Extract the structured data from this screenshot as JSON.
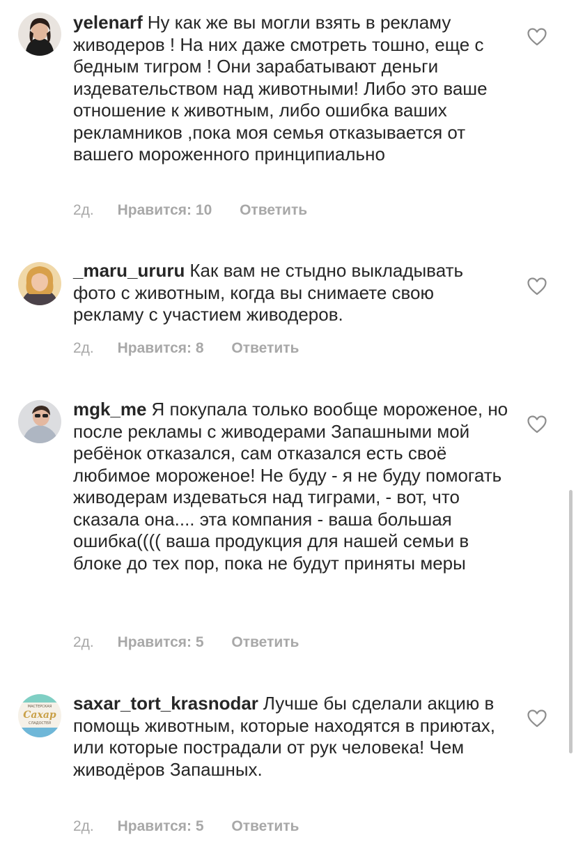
{
  "comments": [
    {
      "username": "yelenarf",
      "text": "Ну как же вы могли взять в рекламу живодеров ! На них даже смотреть тошно, еще с бедным тигром ! Они зарабатывают деньги издевательством над животными! Либо это ваше отношение к животным, либо ошибка  ваших рекламников ,пока моя семья отказывается от вашего мороженного принципиально",
      "time": "2д.",
      "likes": "Нравится: 10",
      "reply": "Ответить"
    },
    {
      "username": "_maru_ururu",
      "text": "Как вам не стыдно выкладывать фото с животным, когда вы снимаете свою рекламу с участием живодеров.",
      "time": "2д.",
      "likes": "Нравится: 8",
      "reply": "Ответить"
    },
    {
      "username": "mgk_me",
      "text": "Я покупала только вообще мороженое, но после рекламы с живодерами Запашными мой ребёнок отказался, сам отказался есть своё любимое мороженое! Не буду - я не буду помогать живодерам издеваться над тиграми, - вот, что сказала она.... эта компания - ваша большая ошибка(((( ваша продукция для нашей семьи в блоке до тех пор, пока не будут приняты меры",
      "time": "2д.",
      "likes": "Нравится: 5",
      "reply": "Ответить"
    },
    {
      "username": "saxar_tort_krasnodar",
      "text": "Лучше бы сделали акцию в помощь животным, которые находятся в приютах, или которые пострадали от рук человека!  Чем живодёров Запашных.",
      "time": "2д.",
      "likes": "Нравится: 5",
      "reply": "Ответить"
    }
  ],
  "avatar_logo": {
    "line1": "МАСТЕРСКАЯ",
    "line2": "Сахар",
    "line3": "СЛАДОСТЕЙ"
  },
  "colors": {
    "text": "#262626",
    "meta": "#a8a8a8",
    "heart": "#8e8e8e"
  },
  "icons": {
    "like": "heart-outline-icon"
  }
}
